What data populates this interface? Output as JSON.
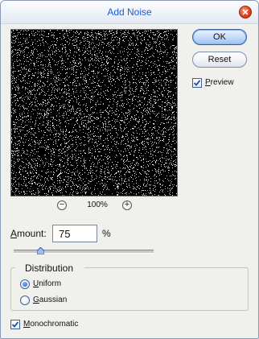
{
  "window": {
    "title": "Add Noise"
  },
  "preview": {
    "zoom_out_symbol": "−",
    "zoom_level": "100%",
    "zoom_in_symbol": "+"
  },
  "buttons": {
    "ok_label": "OK",
    "reset_label": "Reset"
  },
  "preview_option": {
    "label_first": "P",
    "label_rest": "review",
    "checked": true
  },
  "amount": {
    "label_first": "A",
    "label_rest": "mount:",
    "value": "75",
    "unit": "%",
    "slider_percent": 19
  },
  "distribution": {
    "legend": "Distribution",
    "options": [
      {
        "first": "U",
        "rest": "niform",
        "selected": true
      },
      {
        "first": "G",
        "rest": "aussian",
        "selected": false
      }
    ]
  },
  "monochromatic": {
    "label_first": "M",
    "label_rest": "onochromatic",
    "checked": true
  },
  "colors": {
    "title_text": "#1c5dd0",
    "close_button": "#e0411b",
    "check_mark": "#1f4fa8"
  },
  "icons": {
    "close": "close-icon",
    "check": "checkmark-icon",
    "zoom_out": "zoom-out-icon",
    "zoom_in": "zoom-in-icon"
  }
}
